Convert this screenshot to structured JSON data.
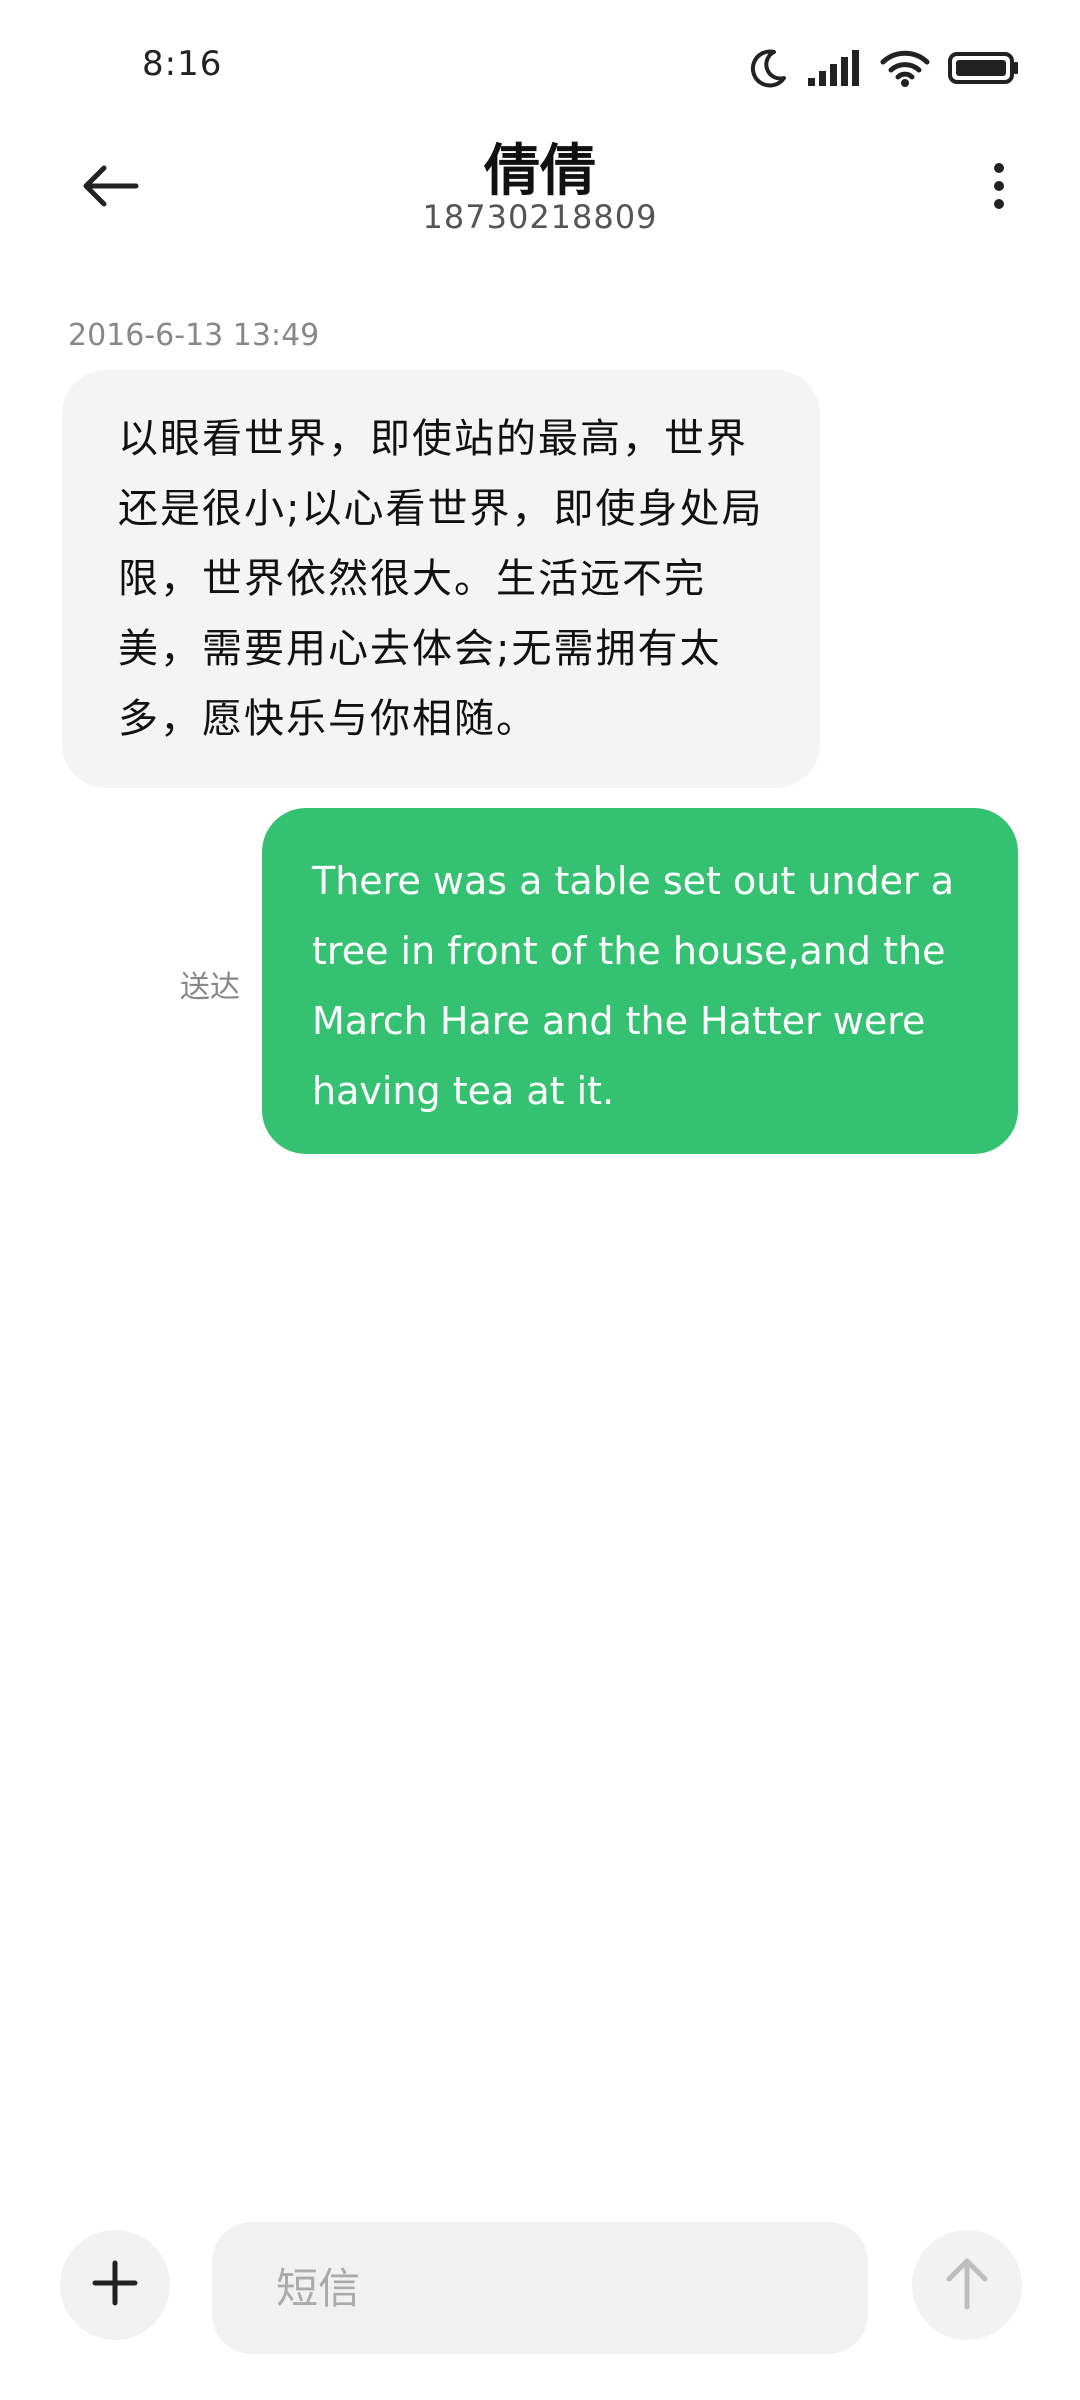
{
  "status_bar": {
    "time": "8:16",
    "icons": [
      "moon-icon",
      "signal-icon",
      "wifi-icon",
      "battery-icon"
    ]
  },
  "header": {
    "back_icon": "arrow-left-icon",
    "contact_name": "倩倩",
    "contact_number": "18730218809",
    "more_icon": "more-vertical-icon"
  },
  "conversation": {
    "timestamp": "2016-6-13 13:49",
    "received_message": "以眼看世界，即使站的最高，世界还是很小;以心看世界，即使身处局限，世界依然很大。生活远不完美，需要用心去体会;无需拥有太多，愿快乐与你相随。",
    "sent_message": "There was a table set out under a tree in front of the house,and the March Hare and the Hatter were having tea at it.",
    "delivery_status": "送达"
  },
  "input_bar": {
    "add_icon": "plus-icon",
    "placeholder": "短信",
    "value": "",
    "send_icon": "arrow-up-icon"
  },
  "colors": {
    "sent_bubble": "#34c172",
    "received_bubble": "#f4f4f4",
    "meta_text": "#888888"
  }
}
